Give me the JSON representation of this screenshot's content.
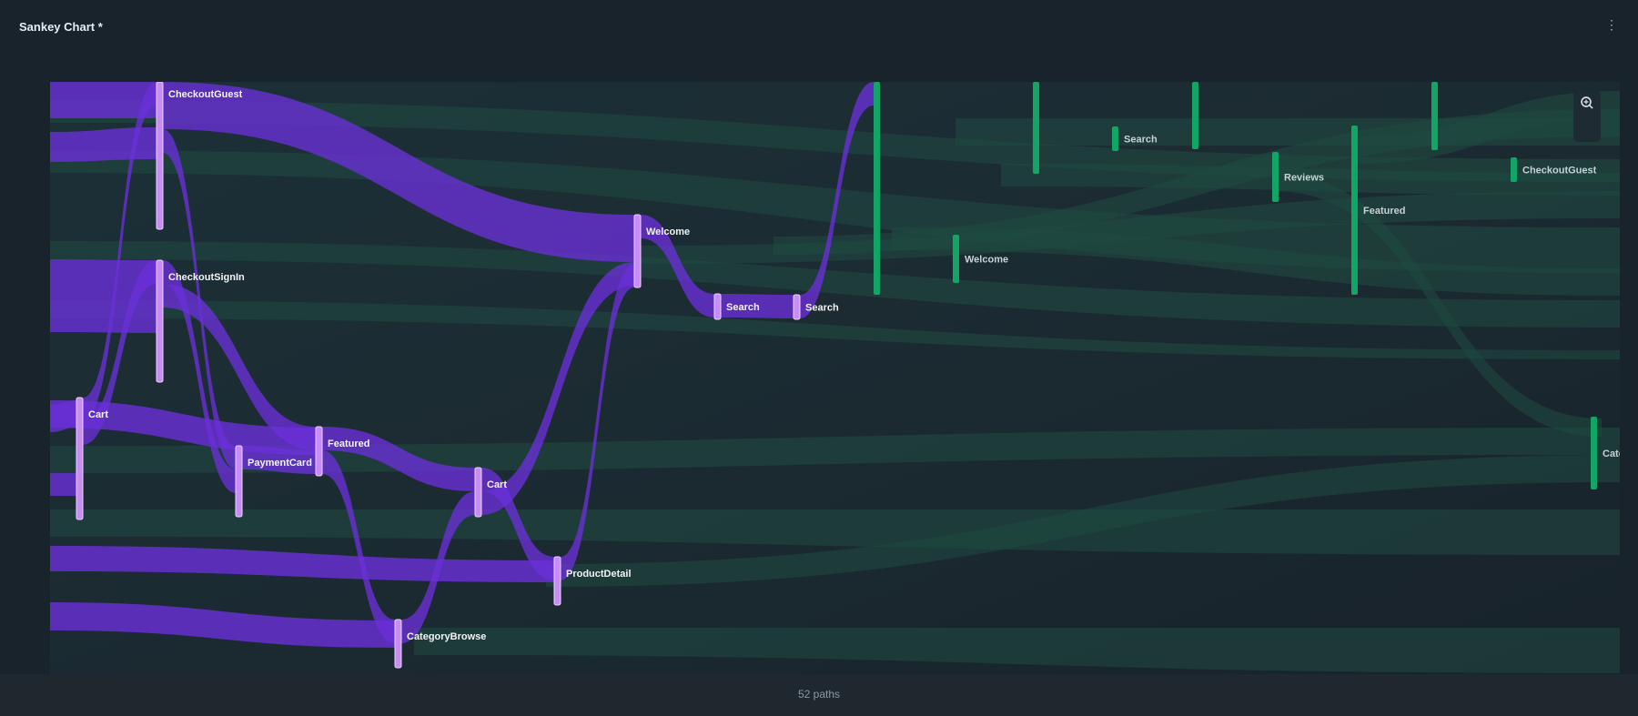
{
  "window": {
    "title": "Sankey Chart *"
  },
  "footer": {
    "paths_text": "52 paths"
  },
  "toolbar": {
    "zoom_in": "zoom-in",
    "zoom_out": "zoom-out"
  },
  "colors": {
    "highlight_node": "#c98cf5",
    "highlight_link": "#6a2fd8",
    "dim_node": "#12a566",
    "dim_link": "#1f4a41",
    "label_light": "#f2f4f6",
    "label_dim": "#c7d1d6"
  },
  "chart_data": {
    "type": "sankey",
    "title": "",
    "nodes": [
      {
        "id": "a",
        "label": "Cart",
        "step": 1,
        "highlight": true
      },
      {
        "id": "b",
        "label": "CheckoutGuest",
        "step": 2,
        "highlight": true
      },
      {
        "id": "c",
        "label": "CheckoutSignIn",
        "step": 2,
        "highlight": true
      },
      {
        "id": "d",
        "label": "PaymentCard",
        "step": 3,
        "highlight": true
      },
      {
        "id": "e",
        "label": "Featured",
        "step": 4,
        "highlight": true
      },
      {
        "id": "f",
        "label": "CategoryBrowse",
        "step": 5,
        "highlight": true
      },
      {
        "id": "g",
        "label": "Cart",
        "step": 6,
        "highlight": true
      },
      {
        "id": "h",
        "label": "ProductDetail",
        "step": 7,
        "highlight": true
      },
      {
        "id": "i",
        "label": "Welcome",
        "step": 8,
        "highlight": true
      },
      {
        "id": "j",
        "label": "Search",
        "step": 9,
        "highlight": true
      },
      {
        "id": "k",
        "label": "Search",
        "step": 10,
        "highlight": true
      },
      {
        "id": "l",
        "label": "",
        "step": 11,
        "highlight": false
      },
      {
        "id": "m",
        "label": "Welcome",
        "step": 12,
        "highlight": false
      },
      {
        "id": "n",
        "label": "",
        "step": 13,
        "highlight": false
      },
      {
        "id": "o",
        "label": "Search",
        "step": 14,
        "highlight": false
      },
      {
        "id": "p",
        "label": "",
        "step": 15,
        "highlight": false
      },
      {
        "id": "q",
        "label": "Reviews",
        "step": 16,
        "highlight": false
      },
      {
        "id": "r",
        "label": "Featured",
        "step": 17,
        "highlight": false
      },
      {
        "id": "s",
        "label": "",
        "step": 18,
        "highlight": false
      },
      {
        "id": "t",
        "label": "CheckoutGuest",
        "step": 19,
        "highlight": false
      },
      {
        "id": "u",
        "label": "Cate",
        "step": 20,
        "highlight": false
      }
    ],
    "links": [
      {
        "from": "b",
        "to": "i",
        "value": 2
      },
      {
        "from": "a",
        "to": "b",
        "value": 1
      },
      {
        "from": "a",
        "to": "c",
        "value": 1
      },
      {
        "from": "b",
        "to": "d",
        "value": 1
      },
      {
        "from": "c",
        "to": "d",
        "value": 1
      },
      {
        "from": "c",
        "to": "e",
        "value": 1
      },
      {
        "from": "d",
        "to": "e",
        "value": 1
      },
      {
        "from": "e",
        "to": "g",
        "value": 1
      },
      {
        "from": "e",
        "to": "f",
        "value": 1
      },
      {
        "from": "f",
        "to": "g",
        "value": 1
      },
      {
        "from": "g",
        "to": "h",
        "value": 1
      },
      {
        "from": "g",
        "to": "i",
        "value": 1
      },
      {
        "from": "h",
        "to": "i",
        "value": 1
      },
      {
        "from": "i",
        "to": "j",
        "value": 1
      },
      {
        "from": "j",
        "to": "k",
        "value": 1
      },
      {
        "from": "k",
        "to": "l",
        "value": 1
      }
    ]
  }
}
